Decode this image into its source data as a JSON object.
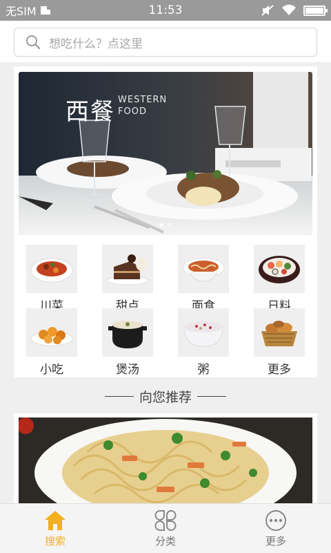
{
  "status_bar": {
    "carrier": "无SIM",
    "time": "11:53",
    "icons": [
      "sim-card-icon",
      "mute-icon",
      "wifi-icon",
      "battery-icon"
    ]
  },
  "search": {
    "placeholder": "想吃什么？点这里",
    "icon": "search-icon"
  },
  "banner": {
    "title": "西餐",
    "subtitle_line1": "WESTERN",
    "subtitle_line2": "FOOD",
    "page_count": 2,
    "active_page": 1
  },
  "categories": [
    {
      "label": "川菜",
      "icon": "sichuan-dish-icon"
    },
    {
      "label": "甜点",
      "icon": "dessert-icon"
    },
    {
      "label": "面食",
      "icon": "noodles-icon"
    },
    {
      "label": "日料",
      "icon": "japanese-food-icon"
    },
    {
      "label": "小吃",
      "icon": "snack-icon"
    },
    {
      "label": "煲汤",
      "icon": "soup-pot-icon"
    },
    {
      "label": "粥",
      "icon": "porridge-icon"
    },
    {
      "label": "更多",
      "icon": "more-food-icon"
    }
  ],
  "section": {
    "title": "向您推荐"
  },
  "bottom_nav": {
    "items": [
      {
        "label": "搜索",
        "icon": "home-icon",
        "active": true
      },
      {
        "label": "分类",
        "icon": "category-icon",
        "active": false
      },
      {
        "label": "更多",
        "icon": "more-icon",
        "active": false
      }
    ]
  },
  "colors": {
    "accent": "#f2b11c",
    "status_bar": "#9a9a9a",
    "background": "#efefef"
  }
}
